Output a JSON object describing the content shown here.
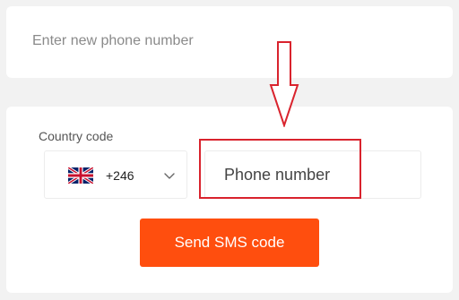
{
  "new_phone_card": {
    "placeholder": "Enter new phone number"
  },
  "sms_form": {
    "country_code_label": "Country code",
    "country_select": {
      "flag_icon": "uk-flag-icon",
      "selected_dial_code": "+246",
      "dropdown_icon": "chevron-down-icon"
    },
    "phone_input": {
      "placeholder": "Phone number",
      "value": ""
    },
    "send_button_label": "Send SMS code"
  },
  "annotation": {
    "arrow_icon": "down-arrow-icon",
    "highlight_color": "#d9232d"
  },
  "colors": {
    "background": "#f2f2f2",
    "card": "#ffffff",
    "button": "#ff4e0e"
  }
}
